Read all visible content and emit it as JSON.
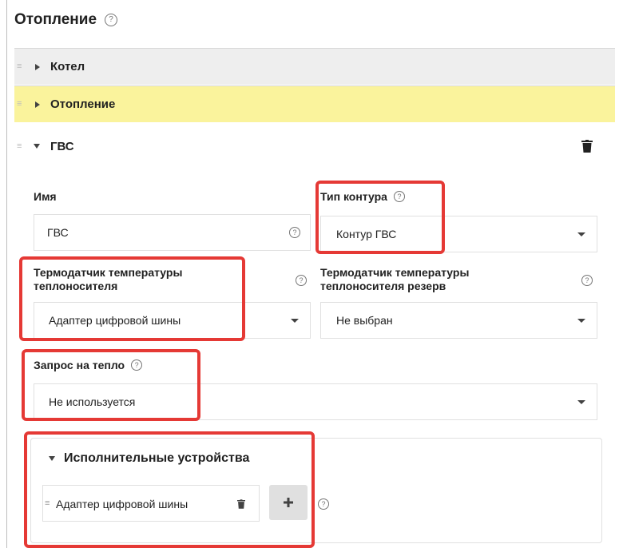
{
  "section": {
    "title": "Отопление"
  },
  "panels": [
    {
      "label": "Котел",
      "expanded": false
    },
    {
      "label": "Отопление",
      "expanded": false
    },
    {
      "label": "ГВС",
      "expanded": true
    }
  ],
  "form": {
    "name": {
      "label": "Имя",
      "value": "ГВС"
    },
    "circuit_type": {
      "label": "Тип контура",
      "value": "Контур ГВС"
    },
    "sensor": {
      "label_line1": "Термодатчик температуры",
      "label_line2": "теплоносителя",
      "value": "Адаптер цифровой шины"
    },
    "sensor_reserve": {
      "label_line1": "Термодатчик температуры",
      "label_line2": "теплоносителя резерв",
      "value": "Не выбран"
    },
    "heat_request": {
      "label": "Запрос на тепло",
      "value": "Не используется"
    }
  },
  "actuators": {
    "title": "Исполнительные устройства",
    "items": [
      "Адаптер цифровой шины"
    ]
  },
  "colors": {
    "highlight_red": "#e53935",
    "yellow_panel": "#faf39c",
    "gray_panel": "#eeeeee"
  }
}
